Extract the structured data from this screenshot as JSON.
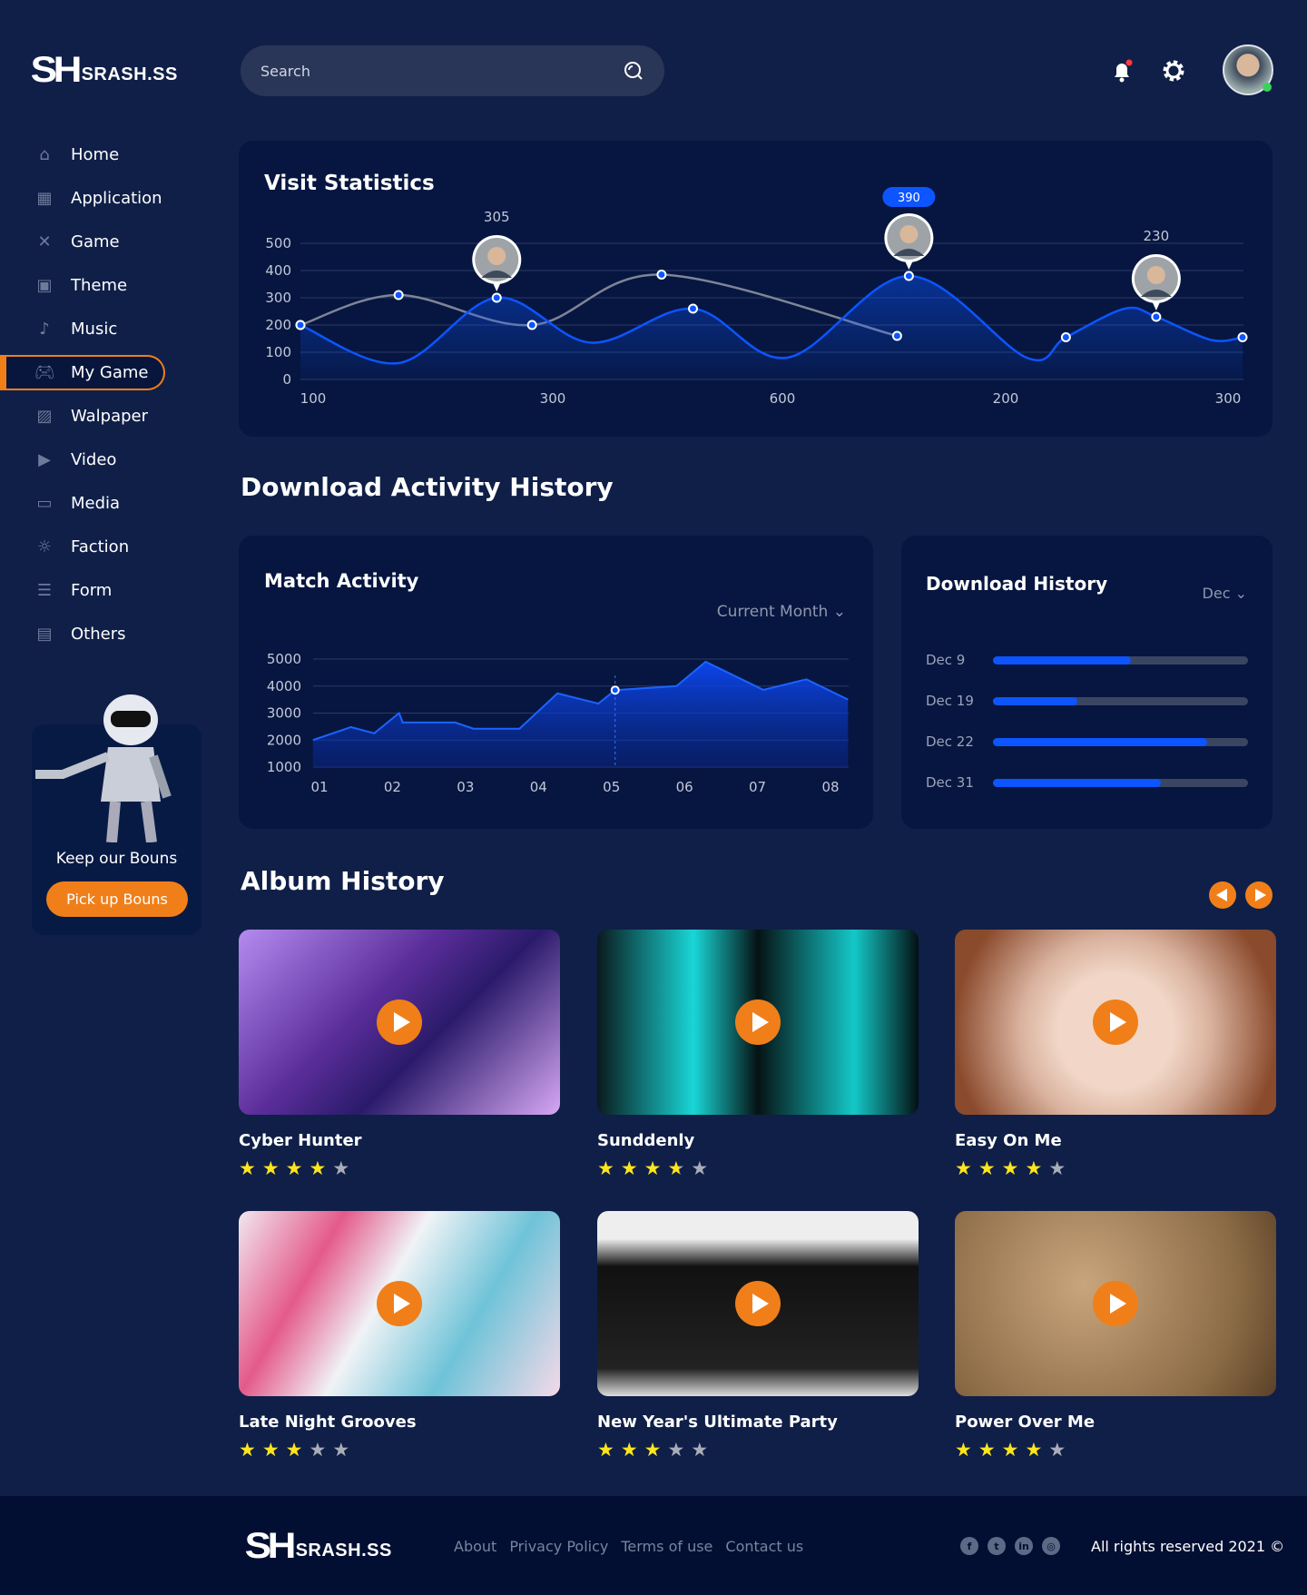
{
  "brand": {
    "mark": "SH",
    "name": "SRASH.SS"
  },
  "header": {
    "search_placeholder": "Search",
    "icons": [
      "search-icon",
      "bell-icon",
      "gear-icon",
      "avatar"
    ],
    "notification_dot_color": "#ff3b3b",
    "online_color": "#3ad35a"
  },
  "sidebar": {
    "items": [
      {
        "label": "Home",
        "icon": "home-icon"
      },
      {
        "label": "Application",
        "icon": "apps-icon"
      },
      {
        "label": "Game",
        "icon": "game-icon"
      },
      {
        "label": "Theme",
        "icon": "theme-icon"
      },
      {
        "label": "Music",
        "icon": "music-icon"
      },
      {
        "label": "My Game",
        "icon": "gamepad-icon",
        "active": true
      },
      {
        "label": "Walpaper",
        "icon": "image-icon"
      },
      {
        "label": "Video",
        "icon": "video-icon"
      },
      {
        "label": "Media",
        "icon": "clapper-icon"
      },
      {
        "label": "Faction",
        "icon": "bulb-icon"
      },
      {
        "label": "Form",
        "icon": "form-icon"
      },
      {
        "label": "Others",
        "icon": "others-icon"
      }
    ]
  },
  "promo": {
    "text": "Keep our Bouns",
    "button": "Pick up Bouns"
  },
  "colors": {
    "accent": "#f07f1a",
    "primary": "#0c55ff",
    "card": "#061640",
    "background": "#0f1f48"
  },
  "visit": {
    "title": "Visit Statistics"
  },
  "section1": "Download Activity History",
  "match": {
    "title": "Match Activity",
    "filter": "Current Month"
  },
  "download": {
    "title": "Download History",
    "filter": "Dec",
    "rows": [
      {
        "label": "Dec 9",
        "percent": 54
      },
      {
        "label": "Dec 19",
        "percent": 33
      },
      {
        "label": "Dec 22",
        "percent": 84
      },
      {
        "label": "Dec 31",
        "percent": 66
      }
    ]
  },
  "albums": {
    "title": "Album History",
    "items": [
      {
        "title": "Cyber Hunter",
        "rating": 4
      },
      {
        "title": "Sunddenly",
        "rating": 3.5
      },
      {
        "title": "Easy On Me",
        "rating": 4
      },
      {
        "title": "Late Night Grooves",
        "rating": 3
      },
      {
        "title": "New Year's Ultimate Party",
        "rating": 3
      },
      {
        "title": "Power Over Me",
        "rating": 4
      }
    ]
  },
  "footer": {
    "links": [
      "About",
      "Privacy Policy",
      "Terms of use",
      "Contact us"
    ],
    "social": [
      "facebook-icon",
      "twitter-icon",
      "linkedin-icon",
      "instagram-icon"
    ],
    "copyright": "All rights reserved 2021"
  },
  "chart_data": [
    {
      "type": "line",
      "title": "Visit Statistics",
      "yticks": [
        0,
        100,
        200,
        300,
        400,
        500
      ],
      "ylim": [
        0,
        500
      ],
      "xticks": [
        "100",
        "300",
        "600",
        "200",
        "300"
      ],
      "grid": true,
      "series": [
        {
          "points": [
            [
              0,
              200
            ],
            [
              2.5,
              60
            ],
            [
              5,
              300
            ],
            [
              7.4,
              135
            ],
            [
              10,
              260
            ],
            [
              12.4,
              80
            ],
            [
              15.5,
              380
            ],
            [
              18.5,
              80
            ],
            [
              19.5,
              155
            ],
            [
              21,
              260
            ],
            [
              21.8,
              230
            ],
            [
              23.2,
              145
            ],
            [
              24,
              155
            ]
          ],
          "color": "#0c55ff",
          "markers": [
            0,
            2,
            4,
            6,
            8,
            10,
            12
          ],
          "area": true
        },
        {
          "points": [
            [
              0,
              200
            ],
            [
              2.5,
              310
            ],
            [
              5.9,
              200
            ],
            [
              9.2,
              385
            ],
            [
              15.2,
              160
            ]
          ],
          "color": "#7f8597",
          "markers": [
            0,
            1,
            2,
            3,
            4
          ]
        }
      ],
      "annotations": [
        {
          "series": 0,
          "point": 2,
          "label": "305"
        },
        {
          "series": 0,
          "point": 6,
          "label": "390",
          "highlight": true
        },
        {
          "series": 0,
          "point": 10,
          "label": "230"
        }
      ]
    },
    {
      "type": "area",
      "title": "Match Activity",
      "yticks": [
        1000,
        2000,
        3000,
        4000,
        5000
      ],
      "ylim": [
        1000,
        5000
      ],
      "xticks": [
        "01",
        "02",
        "03",
        "04",
        "05",
        "06",
        "07",
        "08"
      ],
      "grid": true,
      "points": [
        [
          0.91,
          2000
        ],
        [
          1.43,
          2480
        ],
        [
          1.75,
          2250
        ],
        [
          2.09,
          3000
        ],
        [
          2.14,
          2650
        ],
        [
          2.86,
          2650
        ],
        [
          3.11,
          2420
        ],
        [
          3.74,
          2420
        ],
        [
          4.26,
          3730
        ],
        [
          4.82,
          3350
        ],
        [
          5.05,
          3850
        ],
        [
          5.89,
          4000
        ],
        [
          6.29,
          4900
        ],
        [
          7.08,
          3860
        ],
        [
          7.67,
          4250
        ],
        [
          8.24,
          3500
        ]
      ],
      "highlight_x": 5.05
    }
  ]
}
